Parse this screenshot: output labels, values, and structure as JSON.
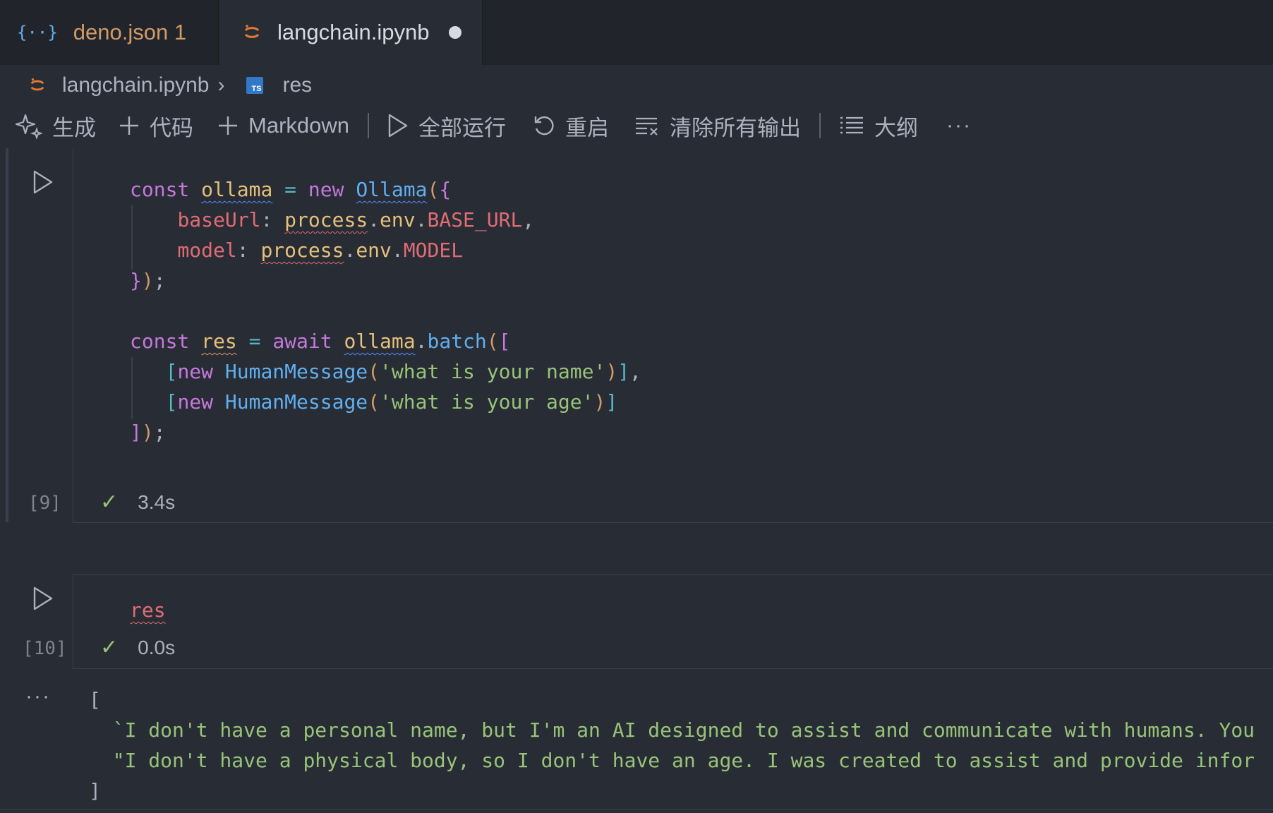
{
  "tabs": [
    {
      "icon": "json-braces-icon",
      "label": "deno.json",
      "badge": "1"
    },
    {
      "icon": "jupyter-notebook-icon",
      "label": "langchain.ipynb",
      "modified": true
    }
  ],
  "breadcrumb": {
    "file": "langchain.ipynb",
    "symbol_icon_text": "TS",
    "symbol": "res"
  },
  "toolbar": {
    "generate": "生成",
    "code": "代码",
    "markdown": "Markdown",
    "run_all": "全部运行",
    "restart": "重启",
    "clear_outputs": "清除所有输出",
    "outline": "大纲",
    "more": "···"
  },
  "cell1": {
    "execution_count": "[9]",
    "duration": "3.4s"
  },
  "cell2": {
    "execution_count": "[10]",
    "duration": "0.0s"
  },
  "output": {
    "more": "···",
    "open": "[",
    "line1": "`I don't have a personal name, but I'm an AI designed to assist and communicate with humans. You",
    "line2": "\"I don't have a physical body, so I don't have an age. I was created to assist and provide infor",
    "close": "]"
  }
}
